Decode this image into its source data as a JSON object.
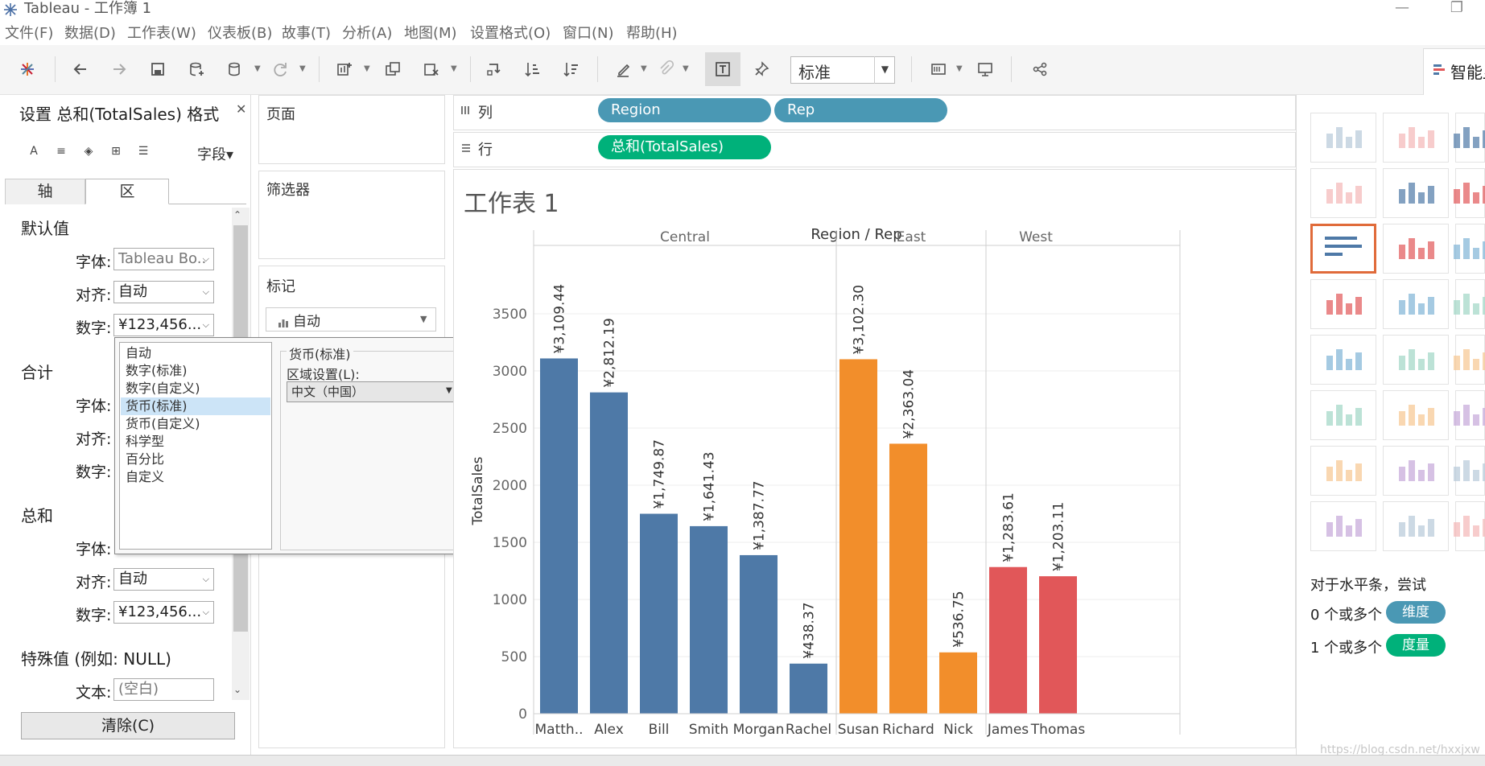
{
  "window": {
    "title": "Tableau - 工作簿 1"
  },
  "menu": [
    "文件(F)",
    "数据(D)",
    "工作表(W)",
    "仪表板(B)",
    "故事(T)",
    "分析(A)",
    "地图(M)",
    "设置格式(O)",
    "窗口(N)",
    "帮助(H)"
  ],
  "toolbar": {
    "fit_dropdown": "标准",
    "show_me_label": "智能显示"
  },
  "format_pane": {
    "title": "设置 总和(TotalSales) 格式",
    "field_button": "字段▾",
    "tabs": [
      "轴",
      "区"
    ],
    "sections": {
      "default": {
        "heading": "默认值",
        "font_label": "字体:",
        "font_value": "Tableau Bo..",
        "align_label": "对齐:",
        "align_value": "自动",
        "number_label": "数字:",
        "number_value": "¥123,456..."
      },
      "totals": {
        "heading": "合计",
        "font_label": "字体:",
        "align_label": "对齐:",
        "number_label": "数字:"
      },
      "grand": {
        "heading": "总和",
        "font_label": "字体:",
        "align_label": "对齐:",
        "align_value": "自动",
        "number_label": "数字:",
        "number_value": "¥123,456..."
      },
      "special": {
        "heading": "特殊值 (例如: NULL)",
        "text_label": "文本:",
        "text_placeholder": "(空白)"
      }
    },
    "clear_button": "清除(C)"
  },
  "number_popup": {
    "options": [
      "自动",
      "数字(标准)",
      "数字(自定义)",
      "货币(标准)",
      "货币(自定义)",
      "科学型",
      "百分比",
      "自定义"
    ],
    "selected": "货币(标准)",
    "group_title": "货币(标准)",
    "locale_label": "区域设置(L):",
    "locale_value": "中文（中国）"
  },
  "cards": {
    "pages": "页面",
    "filters": "筛选器",
    "marks": "标记",
    "marks_type": "自动"
  },
  "shelves": {
    "columns_label": "列",
    "rows_label": "行",
    "columns_pills": [
      "Region",
      "Rep"
    ],
    "rows_pills": [
      "总和(TotalSales)"
    ]
  },
  "sheet": {
    "title": "工作表 1"
  },
  "colors": {
    "central": "#4e79a7",
    "east": "#f28e2b",
    "west": "#e15759",
    "dim_pill": "#4a98b4",
    "measure_pill": "#00b17a",
    "accent": "#e06b3a"
  },
  "chart_data": {
    "type": "bar",
    "title": "Region / Rep",
    "ylabel": "TotalSales",
    "ylim": [
      0,
      4000
    ],
    "yticks": [
      0,
      500,
      1000,
      1500,
      2000,
      2500,
      3000,
      3500
    ],
    "groups": [
      {
        "name": "Central",
        "color": "#4e79a7",
        "categories": [
          "Matth..",
          "Alex",
          "Bill",
          "Smith",
          "Morgan",
          "Rachel"
        ],
        "values": [
          3109.44,
          2812.19,
          1749.87,
          1641.43,
          1387.77,
          438.37
        ],
        "labels": [
          "¥3,109.44",
          "¥2,812.19",
          "¥1,749.87",
          "¥1,641.43",
          "¥1,387.77",
          "¥438.37"
        ]
      },
      {
        "name": "East",
        "color": "#f28e2b",
        "categories": [
          "Susan",
          "Richard",
          "Nick"
        ],
        "values": [
          3102.3,
          2363.04,
          536.75
        ],
        "labels": [
          "¥3,102.30",
          "¥2,363.04",
          "¥536.75"
        ]
      },
      {
        "name": "West",
        "color": "#e15759",
        "categories": [
          "James",
          "Thomas"
        ],
        "values": [
          1283.61,
          1203.11
        ],
        "labels": [
          "¥1,283.61",
          "¥1,203.11"
        ]
      }
    ]
  },
  "show_me": {
    "hint": "对于水平条，尝试",
    "line1_prefix": "0 个或多个",
    "line1_pill": "维度",
    "line2_prefix": "1 个或多个",
    "line2_pill": "度量"
  },
  "watermark": "https://blog.csdn.net/hxxjxw"
}
